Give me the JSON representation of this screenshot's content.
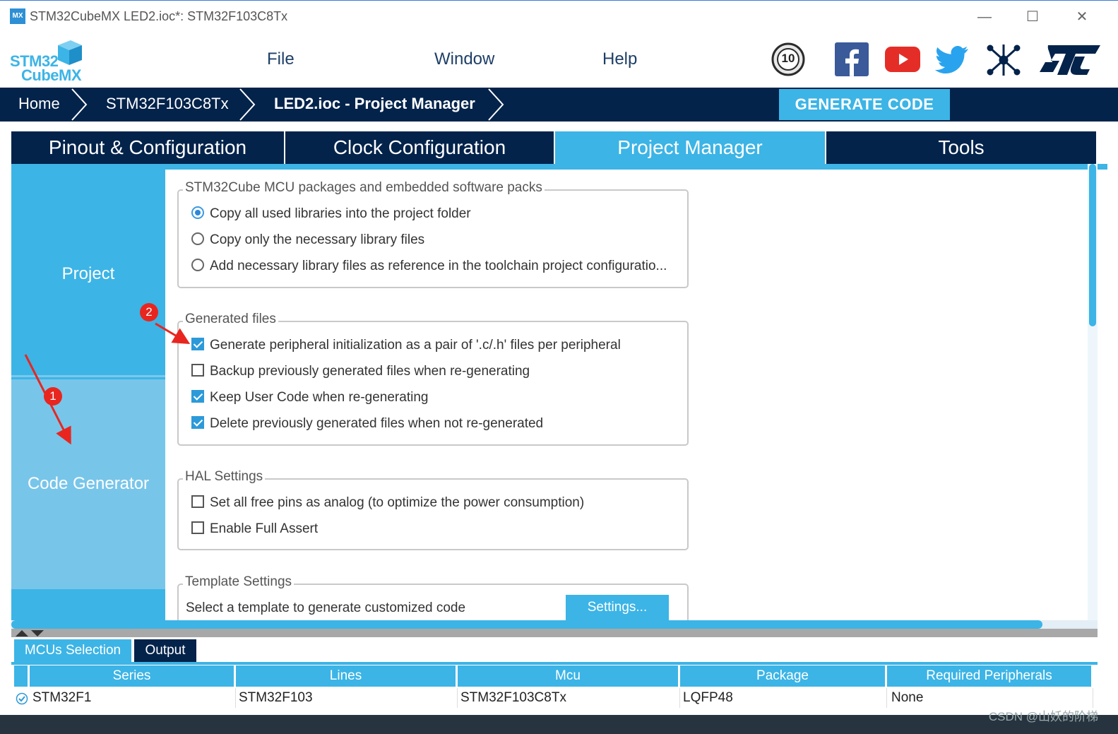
{
  "window": {
    "app_icon": "MX",
    "title": "STM32CubeMX LED2.ioc*: STM32F103C8Tx",
    "minimize": "—",
    "maximize": "☐",
    "close": "✕"
  },
  "logo": {
    "line1": "STM32",
    "line2": "CubeMX"
  },
  "menu": {
    "file": "File",
    "window": "Window",
    "help": "Help"
  },
  "social_icons": [
    "anniversary-badge-icon",
    "facebook-icon",
    "youtube-icon",
    "twitter-icon",
    "network-icon",
    "st-logo-icon"
  ],
  "anniversary_badge_text": "10",
  "breadcrumb": {
    "home": "Home",
    "mcu": "STM32F103C8Tx",
    "current": "LED2.ioc - Project Manager"
  },
  "generate_code": "GENERATE CODE",
  "tabs": [
    {
      "label": "Pinout & Configuration",
      "active": false
    },
    {
      "label": "Clock Configuration",
      "active": false
    },
    {
      "label": "Project Manager",
      "active": true
    },
    {
      "label": "Tools",
      "active": false
    }
  ],
  "sidenav": {
    "project": "Project",
    "code_generator": "Code Generator"
  },
  "groups": {
    "packs": {
      "legend": "STM32Cube MCU packages and embedded software packs",
      "options": [
        {
          "label": "Copy all used libraries into the project folder",
          "checked": true
        },
        {
          "label": "Copy only the necessary library files",
          "checked": false
        },
        {
          "label": "Add necessary library files as reference in the toolchain project configuratio...",
          "checked": false
        }
      ]
    },
    "generated": {
      "legend": "Generated files",
      "options": [
        {
          "label": "Generate peripheral initialization as a pair of '.c/.h' files per peripheral",
          "checked": true
        },
        {
          "label": "Backup previously generated files when re-generating",
          "checked": false
        },
        {
          "label": "Keep User Code when re-generating",
          "checked": true
        },
        {
          "label": "Delete previously generated files when not re-generated",
          "checked": true
        }
      ]
    },
    "hal": {
      "legend": "HAL Settings",
      "options": [
        {
          "label": "Set all free pins as analog (to optimize the power consumption)",
          "checked": false
        },
        {
          "label": "Enable Full Assert",
          "checked": false
        }
      ]
    },
    "template": {
      "legend": "Template Settings",
      "text": "Select a template to generate customized code",
      "button": "Settings..."
    }
  },
  "bottom": {
    "tabs": [
      "MCUs Selection",
      "Output"
    ],
    "columns": [
      "Series",
      "Lines",
      "Mcu",
      "Package",
      "Required Peripherals"
    ],
    "row": {
      "series": "STM32F1",
      "lines": "STM32F103",
      "mcu": "STM32F103C8Tx",
      "package": "LQFP48",
      "required": "None"
    }
  },
  "annotations": {
    "badge1": "1",
    "badge2": "2"
  },
  "watermark": "CSDN @山妖的阶梯",
  "colors": {
    "navy": "#03234b",
    "accent": "#3cb4e6",
    "annotation_red": "#e8261f"
  }
}
